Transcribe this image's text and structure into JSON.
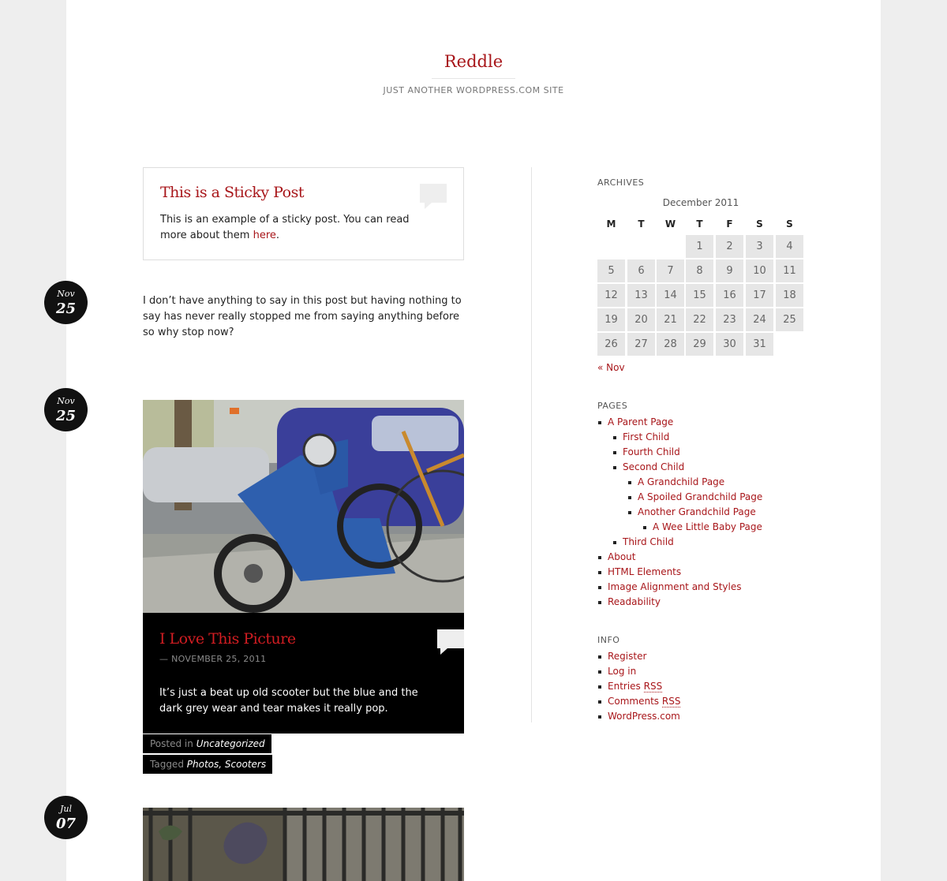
{
  "site": {
    "title": "Reddle",
    "description": "JUST ANOTHER WORDPRESS.COM SITE"
  },
  "sticky_post": {
    "title": "This is a Sticky Post",
    "text_before": "This is an example of a sticky post. You can read more about them ",
    "link": "here",
    "text_after": "."
  },
  "posts": [
    {
      "date_month": "Nov",
      "date_day": "25",
      "text": "I don’t have anything to say in this post but having nothing to say has never really stopped me from saying anything before so why stop now?"
    },
    {
      "date_month": "Nov",
      "date_day": "25",
      "title": "I Love This Picture",
      "date": "— NOVEMBER 25, 2011",
      "text": "It’s just a beat up old scooter but the blue and the dark grey wear and tear makes it really pop.",
      "posted_in_label": "Posted in",
      "category": "Uncategorized",
      "tagged_label": "Tagged",
      "tag1": "Photos",
      "tag_sep": ",",
      "tag2": "Scooters"
    },
    {
      "date_month": "Jul",
      "date_day": "07"
    }
  ],
  "archives": {
    "title": "ARCHIVES",
    "caption": "December 2011",
    "weekdays": [
      "M",
      "T",
      "W",
      "T",
      "F",
      "S",
      "S"
    ],
    "days": [
      "1",
      "2",
      "3",
      "4",
      "5",
      "6",
      "7",
      "8",
      "9",
      "10",
      "11",
      "12",
      "13",
      "14",
      "15",
      "16",
      "17",
      "18",
      "19",
      "20",
      "21",
      "22",
      "23",
      "24",
      "25",
      "26",
      "27",
      "28",
      "29",
      "30",
      "31"
    ],
    "prev_link": "« Nov"
  },
  "pages": {
    "title": "PAGES",
    "items": [
      {
        "label": "A Parent Page",
        "level": 0
      },
      {
        "label": "First Child",
        "level": 1
      },
      {
        "label": "Fourth Child",
        "level": 1
      },
      {
        "label": "Second Child",
        "level": 1
      },
      {
        "label": "A Grandchild Page",
        "level": 2
      },
      {
        "label": "A Spoiled Grandchild Page",
        "level": 2
      },
      {
        "label": "Another Grandchild Page",
        "level": 2
      },
      {
        "label": "A Wee Little Baby Page",
        "level": 3
      },
      {
        "label": "Third Child",
        "level": 1
      },
      {
        "label": "About",
        "level": 0
      },
      {
        "label": "HTML Elements",
        "level": 0
      },
      {
        "label": "Image Alignment and Styles",
        "level": 0
      },
      {
        "label": "Readability",
        "level": 0
      }
    ]
  },
  "info": {
    "title": "INFO",
    "register": "Register",
    "login": "Log in",
    "entries_prefix": "Entries ",
    "comments_prefix": "Comments ",
    "rss": "RSS",
    "wordpress": "WordPress.com"
  },
  "colors": {
    "accent": "#a8161a",
    "page_bg": "#eeeeee",
    "badge_bg": "#111111",
    "calendar_cell": "#e6e6e6"
  }
}
